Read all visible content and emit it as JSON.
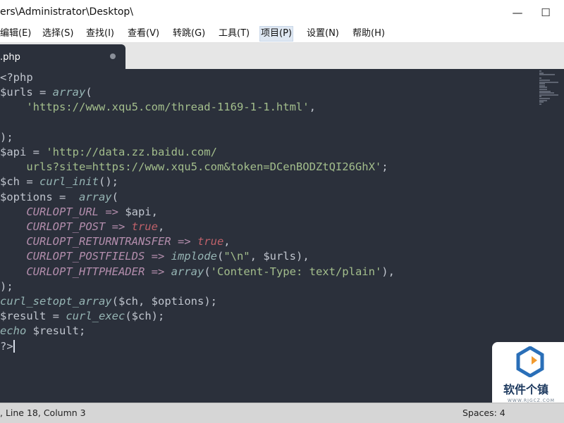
{
  "window": {
    "title": "ers\\Administrator\\Desktop\\",
    "minimize_glyph": "—",
    "maximize_glyph": "☐"
  },
  "menu": {
    "items": [
      {
        "label": "编辑(E)"
      },
      {
        "label": "选择(S)"
      },
      {
        "label": "查找(I)"
      },
      {
        "label": "查看(V)"
      },
      {
        "label": "转跳(G)"
      },
      {
        "label": "工具(T)"
      },
      {
        "label": "项目(P)"
      },
      {
        "label": "设置(N)"
      },
      {
        "label": "帮助(H)"
      }
    ],
    "active_index": 6
  },
  "tab": {
    "label": ".php"
  },
  "code": {
    "lines": [
      [
        {
          "t": "<?php",
          "c": "o"
        }
      ],
      [
        {
          "t": "$urls",
          "c": "o"
        },
        {
          "t": " = ",
          "c": "o"
        },
        {
          "t": "array",
          "c": "f"
        },
        {
          "t": "(",
          "c": "o"
        }
      ],
      [
        {
          "t": "    ",
          "c": "o"
        },
        {
          "t": "'https://www.xqu5.com/thread-1169-1-1.html'",
          "c": "s"
        },
        {
          "t": ",",
          "c": "o"
        }
      ],
      [],
      [
        {
          "t": ");",
          "c": "o"
        }
      ],
      [
        {
          "t": "$api",
          "c": "o"
        },
        {
          "t": " = ",
          "c": "o"
        },
        {
          "t": "'http://data.zz.baidu.com/",
          "c": "s"
        }
      ],
      [
        {
          "t": "    urls?site=https://www.xqu5.com&token=DCenBODZtQI26GhX'",
          "c": "s"
        },
        {
          "t": ";",
          "c": "o"
        }
      ],
      [
        {
          "t": "$ch",
          "c": "o"
        },
        {
          "t": " = ",
          "c": "o"
        },
        {
          "t": "curl_init",
          "c": "f"
        },
        {
          "t": "();",
          "c": "o"
        }
      ],
      [
        {
          "t": "$options",
          "c": "o"
        },
        {
          "t": " =  ",
          "c": "o"
        },
        {
          "t": "array",
          "c": "f"
        },
        {
          "t": "(",
          "c": "o"
        }
      ],
      [
        {
          "t": "    ",
          "c": "o"
        },
        {
          "t": "CURLOPT_URL",
          "c": "cst"
        },
        {
          "t": " => ",
          "c": "k"
        },
        {
          "t": "$api",
          "c": "o"
        },
        {
          "t": ",",
          "c": "o"
        }
      ],
      [
        {
          "t": "    ",
          "c": "o"
        },
        {
          "t": "CURLOPT_POST",
          "c": "cst"
        },
        {
          "t": " => ",
          "c": "k"
        },
        {
          "t": "true",
          "c": "v"
        },
        {
          "t": ",",
          "c": "o"
        }
      ],
      [
        {
          "t": "    ",
          "c": "o"
        },
        {
          "t": "CURLOPT_RETURNTRANSFER",
          "c": "cst"
        },
        {
          "t": " => ",
          "c": "k"
        },
        {
          "t": "true",
          "c": "v"
        },
        {
          "t": ",",
          "c": "o"
        }
      ],
      [
        {
          "t": "    ",
          "c": "o"
        },
        {
          "t": "CURLOPT_POSTFIELDS",
          "c": "cst"
        },
        {
          "t": " => ",
          "c": "k"
        },
        {
          "t": "implode",
          "c": "f"
        },
        {
          "t": "(",
          "c": "o"
        },
        {
          "t": "\"\\n\"",
          "c": "s"
        },
        {
          "t": ", ",
          "c": "o"
        },
        {
          "t": "$urls",
          "c": "o"
        },
        {
          "t": "),",
          "c": "o"
        }
      ],
      [
        {
          "t": "    ",
          "c": "o"
        },
        {
          "t": "CURLOPT_HTTPHEADER",
          "c": "cst"
        },
        {
          "t": " => ",
          "c": "k"
        },
        {
          "t": "array",
          "c": "f"
        },
        {
          "t": "(",
          "c": "o"
        },
        {
          "t": "'Content-Type: text/plain'",
          "c": "s"
        },
        {
          "t": "),",
          "c": "o"
        }
      ],
      [
        {
          "t": ");",
          "c": "o"
        }
      ],
      [
        {
          "t": "curl_setopt_array",
          "c": "f"
        },
        {
          "t": "(",
          "c": "o"
        },
        {
          "t": "$ch",
          "c": "o"
        },
        {
          "t": ", ",
          "c": "o"
        },
        {
          "t": "$options",
          "c": "o"
        },
        {
          "t": ");",
          "c": "o"
        }
      ],
      [
        {
          "t": "$result",
          "c": "o"
        },
        {
          "t": " = ",
          "c": "o"
        },
        {
          "t": "curl_exec",
          "c": "f"
        },
        {
          "t": "(",
          "c": "o"
        },
        {
          "t": "$ch",
          "c": "o"
        },
        {
          "t": ");",
          "c": "o"
        }
      ],
      [
        {
          "t": "echo",
          "c": "f"
        },
        {
          "t": " $result;",
          "c": "o"
        }
      ],
      [
        {
          "t": "?>",
          "c": "o"
        }
      ]
    ]
  },
  "status": {
    "position": ", Line 18, Column 3",
    "spaces": "Spaces: 4"
  },
  "watermark": {
    "name": "软件个镇",
    "sub": "WWW.RJGCZ.COM"
  },
  "colors": {
    "editor_bg": "#2b303b",
    "string": "#a3be8c",
    "keyword": "#b48ead",
    "function": "#96b5b4",
    "boolean": "#bf616a"
  }
}
